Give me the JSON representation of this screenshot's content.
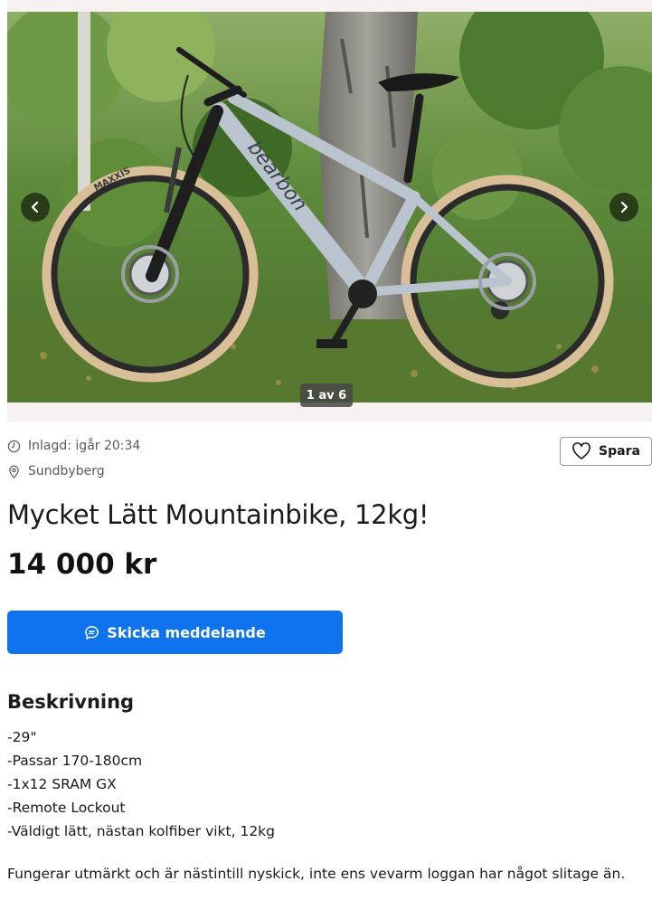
{
  "gallery": {
    "counter": "1 av 6",
    "prev_icon": "chevron-left-icon",
    "next_icon": "chevron-right-icon",
    "tire_brand": "MAXXIS",
    "frame_brand": "bearbon",
    "colors": {
      "frame": "#b9c4cf",
      "tire": "#d9bf98",
      "foliage": "#4f7d35",
      "trunk": "#8e8e86"
    }
  },
  "listing": {
    "posted": "Inlagd: igår 20:34",
    "location": "Sundbyberg",
    "save_label": "Spara",
    "title": "Mycket Lätt Mountainbike, 12kg!",
    "price": "14 000 kr",
    "message_button": "Skicka meddelande"
  },
  "description": {
    "heading": "Beskrivning",
    "lines": [
      "-29\"",
      "-Passar 170-180cm",
      "-1x12 SRAM GX",
      "-Remote Lockout",
      "-Väldigt lätt, nästan kolfiber vikt, 12kg"
    ],
    "paragraph": "Fungerar utmärkt och är nästintill nyskick, inte ens vevarm loggan har något slitage än."
  },
  "theme": {
    "accent": "#0f73ee"
  }
}
